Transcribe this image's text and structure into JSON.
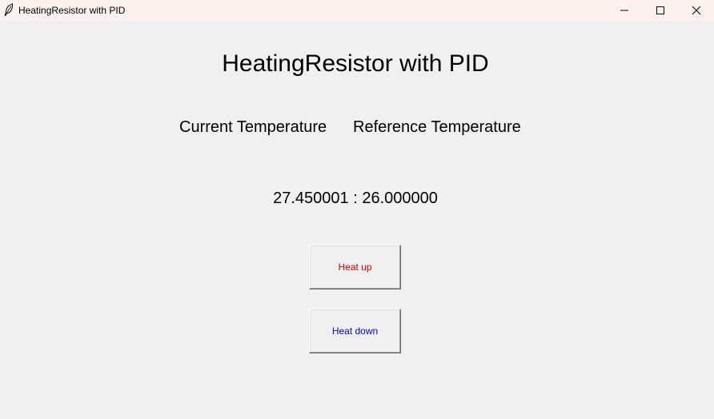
{
  "window": {
    "title": "HeatingResistor with PID",
    "icon": "feather-icon",
    "controls": [
      "minimize-icon",
      "maximize-icon",
      "close-icon"
    ]
  },
  "main": {
    "heading": "HeatingResistor with PID",
    "labels": {
      "current": "Current Temperature",
      "reference": "Reference Temperature"
    },
    "readout": "27.450001 : 26.000000",
    "buttons": {
      "heat_up": {
        "label": "Heat up",
        "color": "#e00000"
      },
      "heat_down": {
        "label": "Heat down",
        "color": "#0000e0"
      }
    }
  }
}
